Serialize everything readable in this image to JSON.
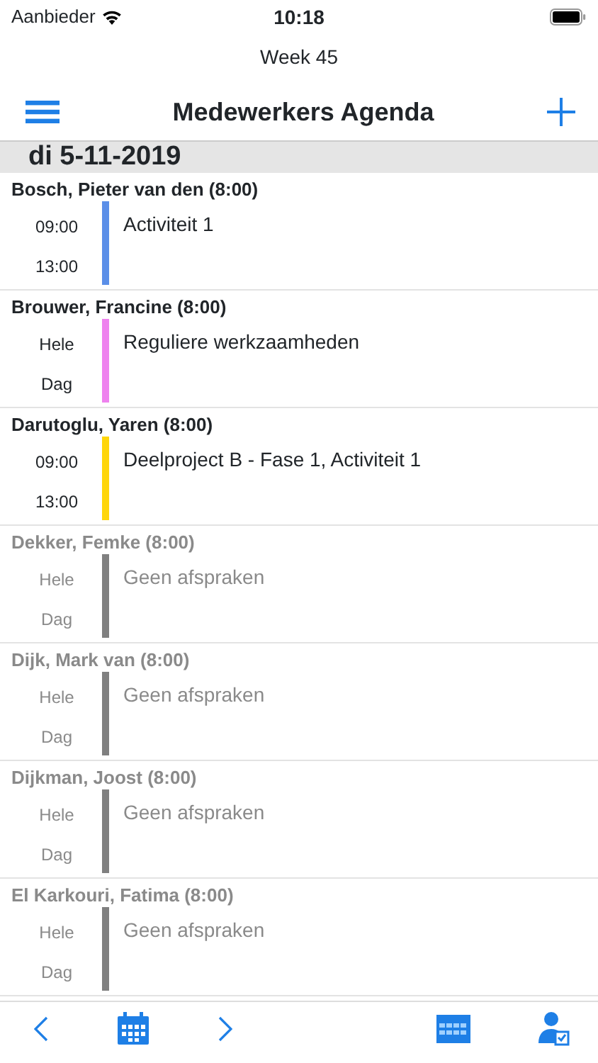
{
  "status_bar": {
    "carrier": "Aanbieder",
    "time": "10:18"
  },
  "week": "Week 45",
  "nav": {
    "title": "Medewerkers Agenda"
  },
  "date_header": "di 5-11-2019",
  "employees": [
    {
      "name": "Bosch, Pieter van den (8:00)",
      "times": [
        "09:00",
        "13:00"
      ],
      "activity": "Activiteit 1",
      "color": "#5b8fe8",
      "muted": false
    },
    {
      "name": "Brouwer, Francine (8:00)",
      "times": [
        "Hele",
        "Dag"
      ],
      "activity": "Reguliere werkzaamheden",
      "color": "#ee82ee",
      "muted": false
    },
    {
      "name": "Darutoglu, Yaren (8:00)",
      "times": [
        "09:00",
        "13:00"
      ],
      "activity": "Deelproject B - Fase 1, Activiteit 1",
      "color": "#ffd60a",
      "muted": false
    },
    {
      "name": "Dekker, Femke (8:00)",
      "times": [
        "Hele",
        "Dag"
      ],
      "activity": "Geen afspraken",
      "color": "#808080",
      "muted": true
    },
    {
      "name": "Dijk, Mark van (8:00)",
      "times": [
        "Hele",
        "Dag"
      ],
      "activity": "Geen afspraken",
      "color": "#808080",
      "muted": true
    },
    {
      "name": "Dijkman, Joost (8:00)",
      "times": [
        "Hele",
        "Dag"
      ],
      "activity": "Geen afspraken",
      "color": "#808080",
      "muted": true
    },
    {
      "name": "El Karkouri, Fatima (8:00)",
      "times": [
        "Hele",
        "Dag"
      ],
      "activity": "Geen afspraken",
      "color": "#808080",
      "muted": true
    }
  ]
}
